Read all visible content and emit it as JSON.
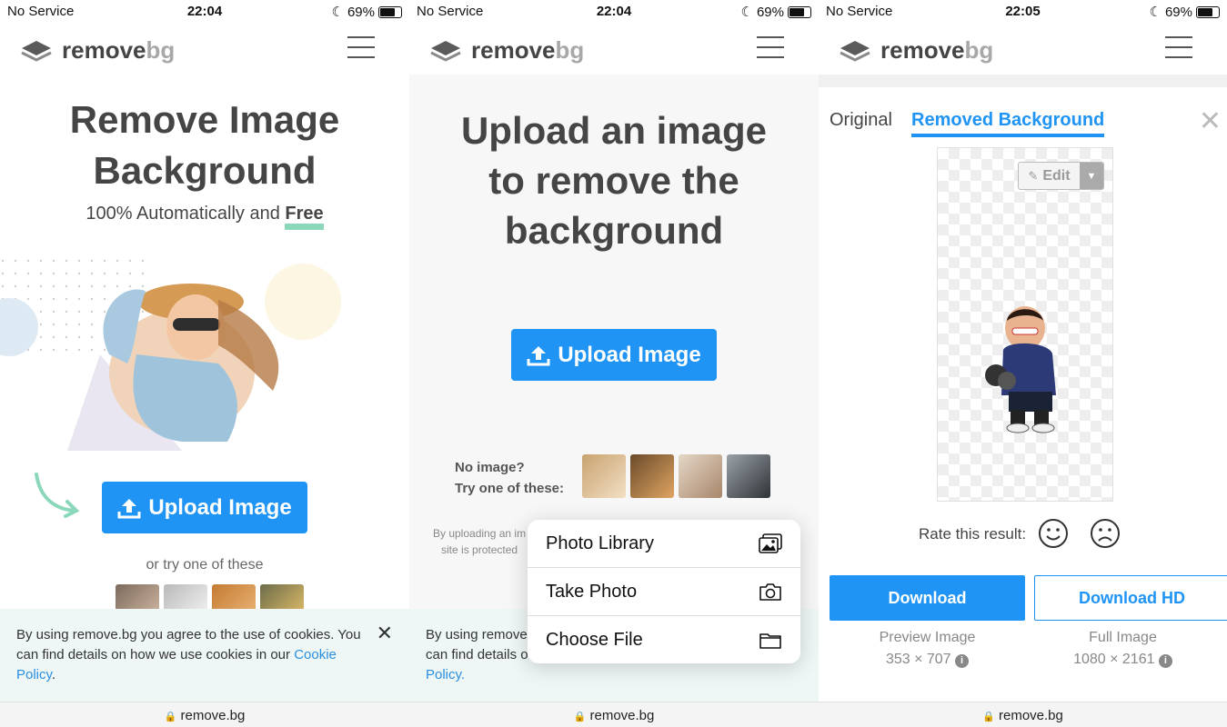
{
  "status": {
    "carrier": "No Service",
    "time1": "22:04",
    "time2": "22:04",
    "time3": "22:05",
    "battery": "69%"
  },
  "brand": {
    "remove": "remove",
    "bg": "bg"
  },
  "address": "remove.bg",
  "panel1": {
    "title_line1": "Remove Image",
    "title_line2": "Background",
    "subtitle": "100% Automatically and",
    "subtitle_bold": "Free",
    "upload_label": "Upload Image",
    "try_label": "or try one of these"
  },
  "panel2": {
    "title_line1": "Upload an image",
    "title_line2": "to remove the",
    "title_line3": "background",
    "upload_label": "Upload Image",
    "no_image": "No image?",
    "try_these": "Try one of these:",
    "fine_print_1": "By uploading an im",
    "fine_print_2": "site is protected",
    "menu": [
      {
        "label": "Photo Library",
        "icon": "photo-library-icon"
      },
      {
        "label": "Take Photo",
        "icon": "camera-icon"
      },
      {
        "label": "Choose File",
        "icon": "folder-icon"
      }
    ]
  },
  "cookie": {
    "text": "By using remove.bg you agree to the use of cookies. You can find details on how we use cookies in our",
    "link": "Cookie Policy",
    "end": ".",
    "text_cut_1": "By using remove",
    "text_cut_2": "can find details o",
    "link_cut": "Policy."
  },
  "panel3": {
    "tab_original": "Original",
    "tab_removed": "Removed Background",
    "edit_label": "Edit",
    "rate_label": "Rate this result:",
    "download_label": "Download",
    "download_hd_label": "Download HD",
    "preview_caption": "Preview Image",
    "preview_size": "353 × 707",
    "full_caption": "Full Image",
    "full_size": "1080 × 2161"
  },
  "colors": {
    "accent": "#1f94f4",
    "text": "#454545",
    "highlight": "#8ad8b9"
  }
}
